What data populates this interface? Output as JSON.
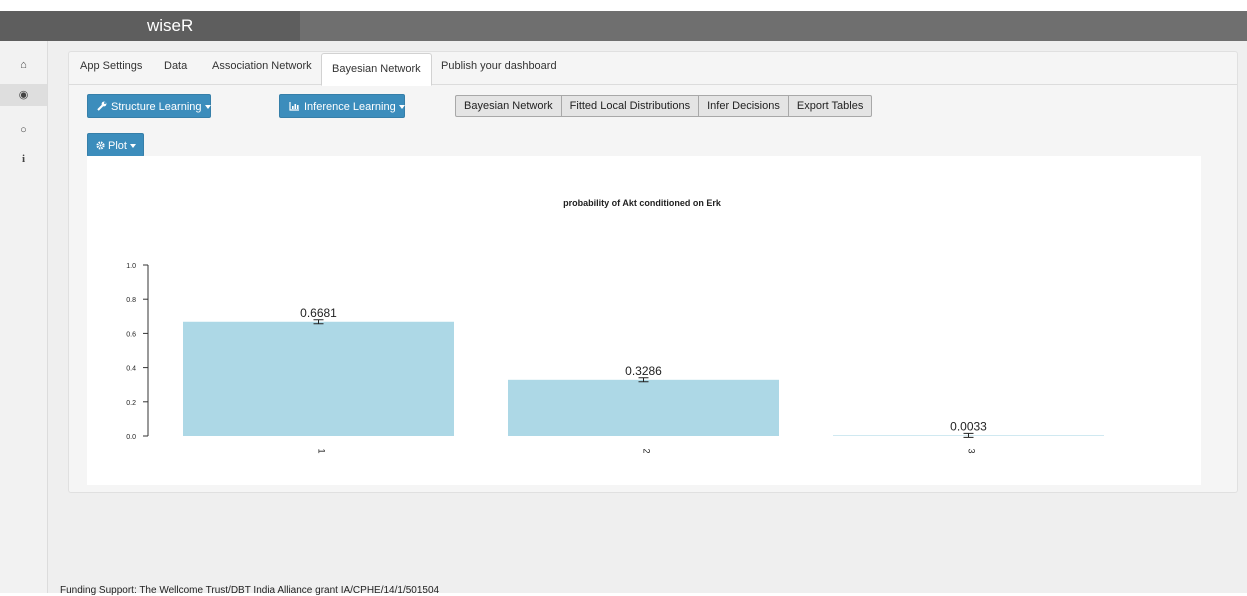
{
  "app": {
    "brand": "wiseR"
  },
  "sidebar": {
    "icons": [
      {
        "name": "home-icon",
        "glyph": "⌂"
      },
      {
        "name": "globe-icon",
        "glyph": "◉"
      },
      {
        "name": "github-icon",
        "glyph": "○"
      },
      {
        "name": "info-icon",
        "glyph": "i"
      }
    ]
  },
  "tabs": {
    "app_settings": "App Settings",
    "data": "Data",
    "association_network": "Association Network",
    "bayesian_network": "Bayesian Network",
    "publish_dashboard": "Publish your dashboard"
  },
  "toolbar": {
    "structure_learning": "Structure Learning",
    "inference_learning": "Inference Learning",
    "plot": "Plot",
    "structure_icon": "wrench-icon",
    "inference_icon": "bar-chart-icon",
    "plot_icon": "gear-icon",
    "accent": "#3c8dbc"
  },
  "view_buttons": {
    "bayesian_network": "Bayesian Network",
    "fitted_local_distributions": "Fitted Local Distributions",
    "infer_decisions": "Infer Decisions",
    "export_tables": "Export Tables"
  },
  "chart_data": {
    "type": "bar",
    "title": "probability of  Akt  conditioned on  Erk",
    "categories": [
      "1",
      "2",
      "3"
    ],
    "values": [
      0.6681,
      0.3286,
      0.0033
    ],
    "value_labels": [
      "0.6681",
      "0.3286",
      "0.0033"
    ],
    "error_bars": true,
    "yticks": [
      "0.0",
      "0.2",
      "0.4",
      "0.6",
      "0.8",
      "1.0"
    ],
    "ylim": [
      0,
      1
    ],
    "bar_color": "#add8e6",
    "xlabel": "",
    "ylabel": ""
  },
  "footer": {
    "text": "Funding Support: The Wellcome Trust/DBT India Alliance grant IA/CPHE/14/1/501504"
  }
}
